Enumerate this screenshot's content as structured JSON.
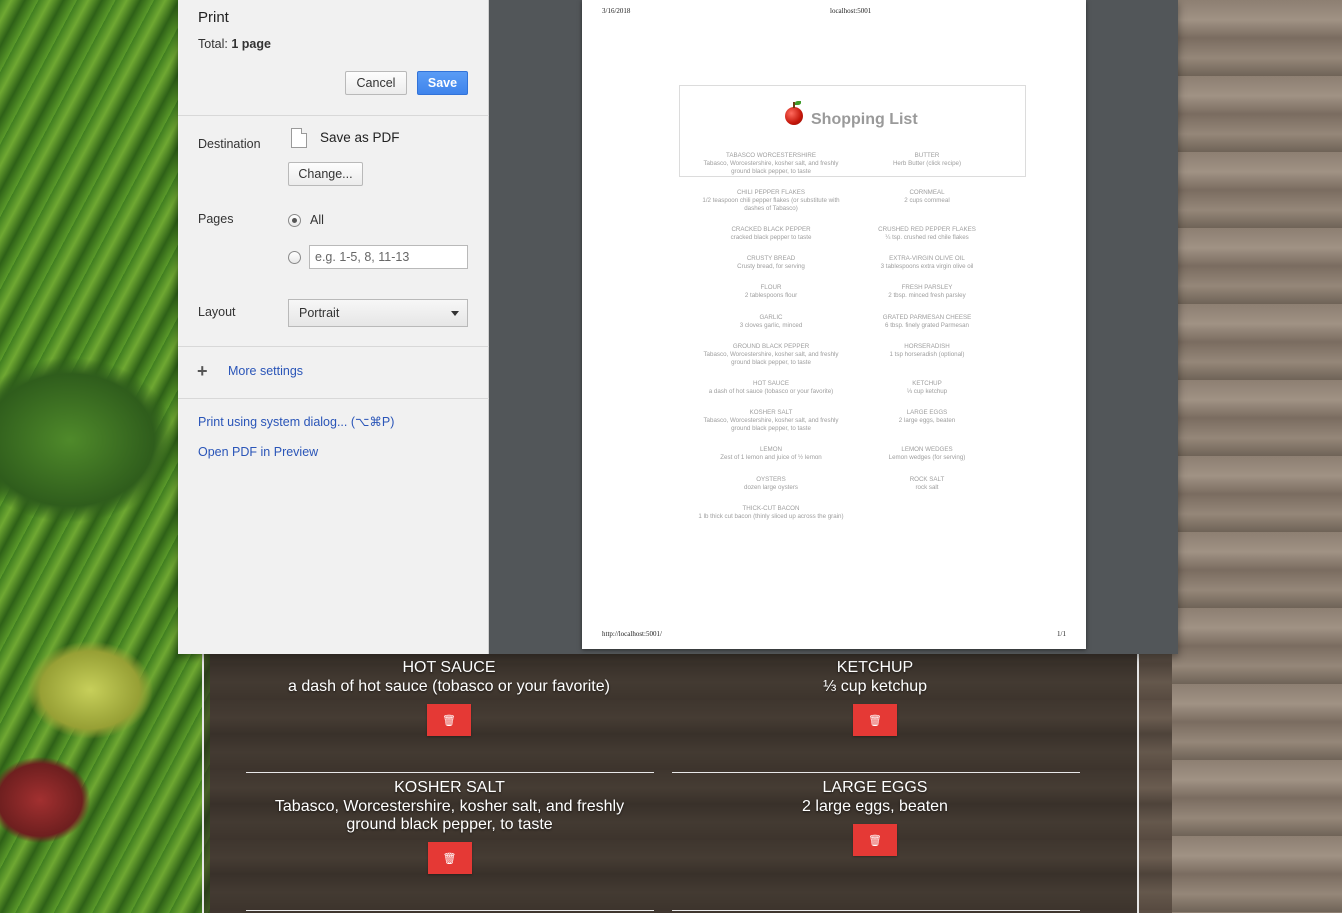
{
  "print": {
    "title": "Print",
    "total_label": "Total:",
    "total_value": "1 page",
    "cancel_label": "Cancel",
    "save_label": "Save",
    "destination_label": "Destination",
    "destination_value": "Save as PDF",
    "change_label": "Change...",
    "pages_label": "Pages",
    "pages_all_label": "All",
    "pages_placeholder": "e.g. 1-5, 8, 11-13",
    "layout_label": "Layout",
    "layout_value": "Portrait",
    "more_settings_label": "More settings",
    "system_dialog_link": "Print using system dialog... (⌥⌘P)",
    "open_pdf_link": "Open PDF in Preview"
  },
  "preview": {
    "header_date": "3/16/2018",
    "header_host": "localhost:5001",
    "footer_url": "http://localhost:5001/",
    "footer_page": "1/1",
    "title": "Shopping List",
    "items": [
      {
        "name": "TABASCO WORCESTERSHIRE",
        "desc": "Tabasco, Worcestershire, kosher salt, and freshly ground black pepper, to taste"
      },
      {
        "name": "BUTTER",
        "desc": "Herb Butter (click recipe)"
      },
      {
        "name": "CHILI PEPPER FLAKES",
        "desc": "1/2 teaspoon chili pepper flakes (or substitute with dashes of Tabasco)"
      },
      {
        "name": "CORNMEAL",
        "desc": "2 cups cornmeal"
      },
      {
        "name": "CRACKED BLACK PEPPER",
        "desc": "cracked black pepper to taste"
      },
      {
        "name": "CRUSHED RED PEPPER FLAKES",
        "desc": "¼ tsp. crushed red chile flakes"
      },
      {
        "name": "CRUSTY BREAD",
        "desc": "Crusty bread, for serving"
      },
      {
        "name": "EXTRA-VIRGIN OLIVE OIL",
        "desc": "3 tablespoons extra virgin olive oil"
      },
      {
        "name": "FLOUR",
        "desc": "2 tablespoons flour"
      },
      {
        "name": "FRESH PARSLEY",
        "desc": "2 tbsp. minced fresh parsley"
      },
      {
        "name": "GARLIC",
        "desc": "3 cloves garlic, minced"
      },
      {
        "name": "GRATED PARMESAN CHEESE",
        "desc": "6 tbsp. finely grated Parmesan"
      },
      {
        "name": "GROUND BLACK PEPPER",
        "desc": "Tabasco, Worcestershire, kosher salt, and freshly ground black pepper, to taste"
      },
      {
        "name": "HORSERADISH",
        "desc": "1 tsp horseradish (optional)"
      },
      {
        "name": "HOT SAUCE",
        "desc": "a dash of hot sauce (tobasco or your favorite)"
      },
      {
        "name": "KETCHUP",
        "desc": "⅓ cup ketchup"
      },
      {
        "name": "KOSHER SALT",
        "desc": "Tabasco, Worcestershire, kosher salt, and freshly ground black pepper, to taste"
      },
      {
        "name": "LARGE EGGS",
        "desc": "2 large eggs, beaten"
      },
      {
        "name": "LEMON",
        "desc": "Zest of 1 lemon and juice of ½ lemon"
      },
      {
        "name": "LEMON WEDGES",
        "desc": "Lemon wedges (for serving)"
      },
      {
        "name": "OYSTERS",
        "desc": "dozen large oysters"
      },
      {
        "name": "ROCK SALT",
        "desc": "rock salt"
      },
      {
        "name": "THICK-CUT BACON",
        "desc": "1 lb thick cut bacon (thinly sliced up across the grain)"
      }
    ]
  },
  "app": {
    "items": [
      {
        "name": "HOT SAUCE",
        "desc": "a dash of hot sauce (tobasco or your favorite)"
      },
      {
        "name": "KETCHUP",
        "desc": "⅓ cup ketchup"
      },
      {
        "name": "KOSHER SALT",
        "desc": "Tabasco, Worcestershire, kosher salt, and freshly ground black pepper, to taste"
      },
      {
        "name": "LARGE EGGS",
        "desc": "2 large eggs, beaten"
      }
    ],
    "delete_icon": "trash-icon"
  },
  "colors": {
    "accent_blue": "#4285f4",
    "delete_red": "#e53935",
    "link_blue": "#2a55b8"
  }
}
